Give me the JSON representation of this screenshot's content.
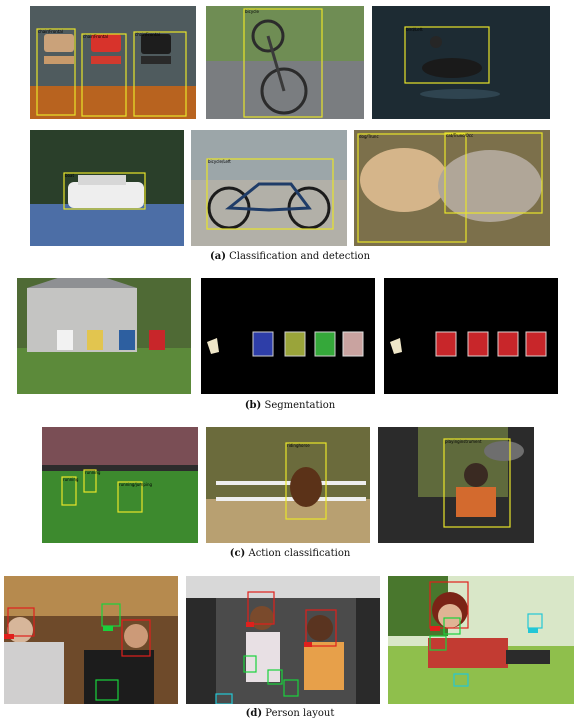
{
  "figure": {
    "captions": {
      "a": {
        "letter": "(a)",
        "text": "Classification and detection"
      },
      "b": {
        "letter": "(b)",
        "text": "Segmentation"
      },
      "c": {
        "letter": "(c)",
        "text": "Action classification"
      },
      "d": {
        "letter": "(d)",
        "text": "Person layout"
      }
    }
  },
  "detection_labels": {
    "chair1": "chair/Frontal",
    "chair2": "chair/Frontal",
    "chair3": "chair/Frontal",
    "bike1": "bicycle",
    "bird": "bird/Left",
    "boat": "boat",
    "bike2": "bicycle/Left",
    "dog": "dog/Trunc",
    "cat": "cat/Trunc/Occ"
  },
  "action_labels": {
    "soccer1": "running",
    "soccer2": "running",
    "soccer3": "running/jumping",
    "horse": "ridinghorse",
    "drums": "playinginstrument"
  },
  "colors": {
    "detection_box": "#e8e42a",
    "hand_box": "#19d23c",
    "head_box": "#e0201c",
    "foot_box": "#23c7d6"
  }
}
